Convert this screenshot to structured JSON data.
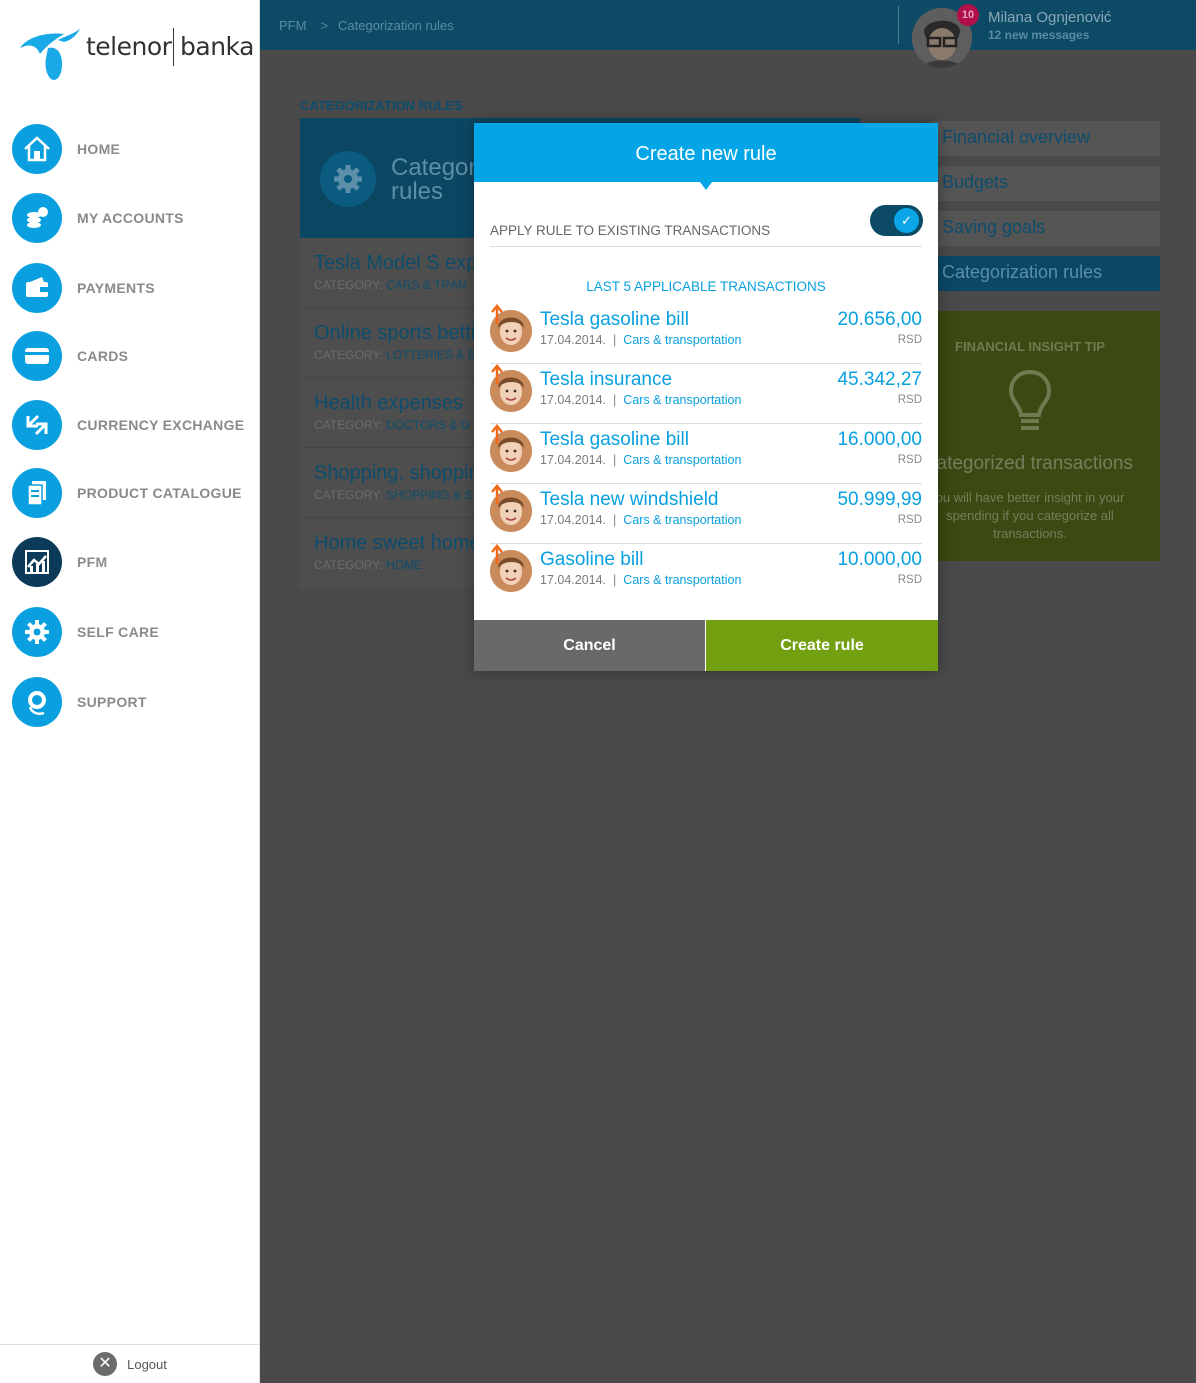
{
  "brand": {
    "left": "telenor",
    "right": "banka"
  },
  "sidebar": {
    "items": [
      {
        "label": "HOME",
        "icon": "home-icon"
      },
      {
        "label": "MY ACCOUNTS",
        "icon": "coins-icon"
      },
      {
        "label": "PAYMENTS",
        "icon": "wallet-icon"
      },
      {
        "label": "CARDS",
        "icon": "card-icon"
      },
      {
        "label": "CURRENCY EXCHANGE",
        "icon": "exchange-icon"
      },
      {
        "label": "PRODUCT CATALOGUE",
        "icon": "catalogue-icon"
      },
      {
        "label": "PFM",
        "icon": "chart-icon"
      },
      {
        "label": "SELF CARE",
        "icon": "gear-icon"
      },
      {
        "label": "SUPPORT",
        "icon": "headset-icon"
      }
    ],
    "logout": "Logout"
  },
  "topbar": {
    "breadcrumb": [
      "PFM",
      "Categorization rules"
    ],
    "user_name": "Milana Ognjenović",
    "messages": "12 new messages",
    "badge": "10"
  },
  "page": {
    "title": "CATEGORIZATION RULES",
    "card_title_1": "Categor",
    "card_title_2": "rules",
    "category_prefix": "CATEGORY:",
    "rules": [
      {
        "name": "Tesla Model S expe",
        "category": "CARS & TRAN"
      },
      {
        "name": "Online sports betti",
        "category": "LOTTERIES & B"
      },
      {
        "name": "Health expenses",
        "category": "DOCTORS & D"
      },
      {
        "name": "Shopping, shoppin",
        "category": "SHOPPING & S"
      },
      {
        "name": "Home sweet home",
        "category": "HOME"
      }
    ],
    "side_menu": [
      "Financial overview",
      "Budgets",
      "Saving goals",
      "Categorization rules"
    ],
    "tip": {
      "title": "FINANCIAL INSIGHT TIP",
      "heading": "categorized transactions",
      "body": "ou will have better insight in your spending if you categorize all transactions."
    }
  },
  "modal": {
    "title": "Create new rule",
    "apply_label": "APPLY RULE TO EXISTING TRANSACTIONS",
    "apply_enabled": true,
    "last5_label": "LAST 5 APPLICABLE TRANSACTIONS",
    "transactions": [
      {
        "name": "Tesla gasoline bill",
        "date": "17.04.2014.",
        "category": "Cars & transportation",
        "amount": "20.656,00",
        "currency": "RSD"
      },
      {
        "name": "Tesla insurance",
        "date": "17.04.2014.",
        "category": "Cars & transportation",
        "amount": "45.342,27",
        "currency": "RSD"
      },
      {
        "name": "Tesla gasoline bill",
        "date": "17.04.2014.",
        "category": "Cars & transportation",
        "amount": "16.000,00",
        "currency": "RSD"
      },
      {
        "name": "Tesla new windshield",
        "date": "17.04.2014.",
        "category": "Cars & transportation",
        "amount": "50.999,99",
        "currency": "RSD"
      },
      {
        "name": "Gasoline bill",
        "date": "17.04.2014.",
        "category": "Cars & transportation",
        "amount": "10.000,00",
        "currency": "RSD"
      }
    ],
    "cancel_label": "Cancel",
    "create_label": "Create rule"
  },
  "colors": {
    "accent": "#04a5e6",
    "nav": "#0aa0df",
    "nav_active": "#0b3b58",
    "create_button": "#73a011",
    "cancel_button": "#696969"
  }
}
